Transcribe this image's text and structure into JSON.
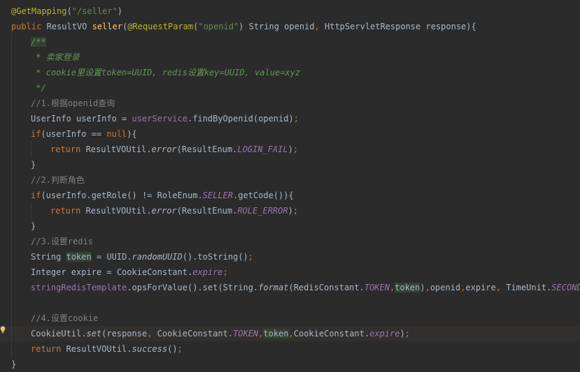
{
  "editor": {
    "lines": [
      {
        "indent": 0,
        "tokens": [
          {
            "t": "@GetMapping",
            "c": "ann"
          },
          {
            "t": "("
          },
          {
            "t": "\"/seller\"",
            "c": "str"
          },
          {
            "t": ")"
          }
        ]
      },
      {
        "indent": 0,
        "tokens": [
          {
            "t": "public",
            "c": "kw"
          },
          {
            "t": " ResultVO "
          },
          {
            "t": "seller",
            "c": "fn"
          },
          {
            "t": "("
          },
          {
            "t": "@RequestParam",
            "c": "ann"
          },
          {
            "t": "("
          },
          {
            "t": "\"openid\"",
            "c": "str"
          },
          {
            "t": ") String openid"
          },
          {
            "t": ",",
            "c": "kw"
          },
          {
            "t": " HttpServletResponse response){"
          }
        ]
      },
      {
        "indent": 1,
        "tokens": [
          {
            "t": "/**",
            "c": "doc hl"
          }
        ]
      },
      {
        "indent": 1,
        "tokens": [
          {
            "t": " * 卖家登录",
            "c": "doc"
          }
        ]
      },
      {
        "indent": 1,
        "tokens": [
          {
            "t": " * cookie里设置token=UUID, redis设置key=UUID, value=xyz",
            "c": "doc"
          }
        ]
      },
      {
        "indent": 1,
        "tokens": [
          {
            "t": " */",
            "c": "doc"
          }
        ]
      },
      {
        "indent": 1,
        "tokens": [
          {
            "t": "//1.根据openid查询",
            "c": "cmt"
          }
        ]
      },
      {
        "indent": 1,
        "tokens": [
          {
            "t": "UserInfo userInfo = "
          },
          {
            "t": "userService",
            "c": "ifield"
          },
          {
            "t": ".findByOpenid(openid)"
          },
          {
            "t": ";",
            "c": "kw"
          }
        ]
      },
      {
        "indent": 1,
        "tokens": [
          {
            "t": "if",
            "c": "kw"
          },
          {
            "t": "(userInfo == "
          },
          {
            "t": "null",
            "c": "kw"
          },
          {
            "t": "){"
          }
        ]
      },
      {
        "indent": 2,
        "tokens": [
          {
            "t": "return",
            "c": "kw"
          },
          {
            "t": " ResultVOUtil."
          },
          {
            "t": "error",
            "c": "static"
          },
          {
            "t": "(ResultEnum."
          },
          {
            "t": "LOGIN_FAIL",
            "c": "field"
          },
          {
            "t": ")"
          },
          {
            "t": ";",
            "c": "kw"
          }
        ]
      },
      {
        "indent": 1,
        "tokens": [
          {
            "t": "}"
          }
        ]
      },
      {
        "indent": 1,
        "tokens": [
          {
            "t": "//2.判断角色",
            "c": "cmt"
          }
        ]
      },
      {
        "indent": 1,
        "tokens": [
          {
            "t": "if",
            "c": "kw"
          },
          {
            "t": "(userInfo.getRole() != RoleEnum."
          },
          {
            "t": "SELLER",
            "c": "field"
          },
          {
            "t": ".getCode()){"
          }
        ]
      },
      {
        "indent": 2,
        "tokens": [
          {
            "t": "return",
            "c": "kw"
          },
          {
            "t": " ResultVOUtil."
          },
          {
            "t": "error",
            "c": "static"
          },
          {
            "t": "(ResultEnum."
          },
          {
            "t": "ROLE_ERROR",
            "c": "field"
          },
          {
            "t": ")"
          },
          {
            "t": ";",
            "c": "kw"
          }
        ]
      },
      {
        "indent": 1,
        "tokens": [
          {
            "t": "}"
          }
        ]
      },
      {
        "indent": 1,
        "tokens": [
          {
            "t": "//3.设置redis",
            "c": "cmt"
          }
        ]
      },
      {
        "indent": 1,
        "tokens": [
          {
            "t": "String "
          },
          {
            "t": "token",
            "c": "hl"
          },
          {
            "t": " = UUID."
          },
          {
            "t": "randomUUID",
            "c": "static"
          },
          {
            "t": "().toString()"
          },
          {
            "t": ";",
            "c": "kw"
          }
        ]
      },
      {
        "indent": 1,
        "tokens": [
          {
            "t": "Integer expire = CookieConstant."
          },
          {
            "t": "expire",
            "c": "field"
          },
          {
            "t": ";",
            "c": "kw"
          }
        ]
      },
      {
        "indent": 1,
        "tokens": [
          {
            "t": "stringRedisTemplate",
            "c": "ifield"
          },
          {
            "t": ".opsForValue().set(String."
          },
          {
            "t": "format",
            "c": "static"
          },
          {
            "t": "(RedisConstant."
          },
          {
            "t": "TOKEN",
            "c": "field"
          },
          {
            "t": ",",
            "c": "kw"
          },
          {
            "t": "token",
            "c": "hl"
          },
          {
            "t": ")"
          },
          {
            "t": ",",
            "c": "kw"
          },
          {
            "t": "openid"
          },
          {
            "t": ",",
            "c": "kw"
          },
          {
            "t": "expire"
          },
          {
            "t": ",",
            "c": "kw"
          },
          {
            "t": " TimeUnit."
          },
          {
            "t": "SECONDS",
            "c": "field"
          },
          {
            "t": ")"
          },
          {
            "t": ";",
            "c": "kw"
          }
        ]
      },
      {
        "indent": 1,
        "tokens": []
      },
      {
        "indent": 1,
        "tokens": [
          {
            "t": "//4.设置cookie",
            "c": "cmt"
          }
        ]
      },
      {
        "indent": 1,
        "highlight": true,
        "tokens": [
          {
            "t": "CookieUtil."
          },
          {
            "t": "set",
            "c": "static"
          },
          {
            "t": "(response"
          },
          {
            "t": ",",
            "c": "kw"
          },
          {
            "t": " CookieConstant."
          },
          {
            "t": "TOKEN",
            "c": "field"
          },
          {
            "t": ",",
            "c": "kw"
          },
          {
            "t": "token",
            "c": "hl"
          },
          {
            "t": ",",
            "c": "kw"
          },
          {
            "t": "CookieConstant."
          },
          {
            "t": "expire",
            "c": "field"
          },
          {
            "t": ")"
          },
          {
            "t": ";",
            "c": "kw"
          }
        ]
      },
      {
        "indent": 1,
        "tokens": [
          {
            "t": "return",
            "c": "kw"
          },
          {
            "t": " ResultVOUtil."
          },
          {
            "t": "success",
            "c": "static"
          },
          {
            "t": "()"
          },
          {
            "t": ";",
            "c": "kw"
          }
        ]
      },
      {
        "indent": 0,
        "tokens": [
          {
            "t": "}"
          }
        ]
      }
    ]
  },
  "intention_bulb": {
    "icon": "lightbulb-icon",
    "color": "#e8c46a"
  },
  "colors": {
    "background": "#2b2b2b",
    "keyword": "#cc7832",
    "annotation": "#bbb529",
    "string": "#6a8759",
    "field": "#9876aa",
    "comment": "#808080",
    "doc_comment": "#629755",
    "method_declaration": "#ffc66d",
    "identifier_highlight": "#344134"
  }
}
